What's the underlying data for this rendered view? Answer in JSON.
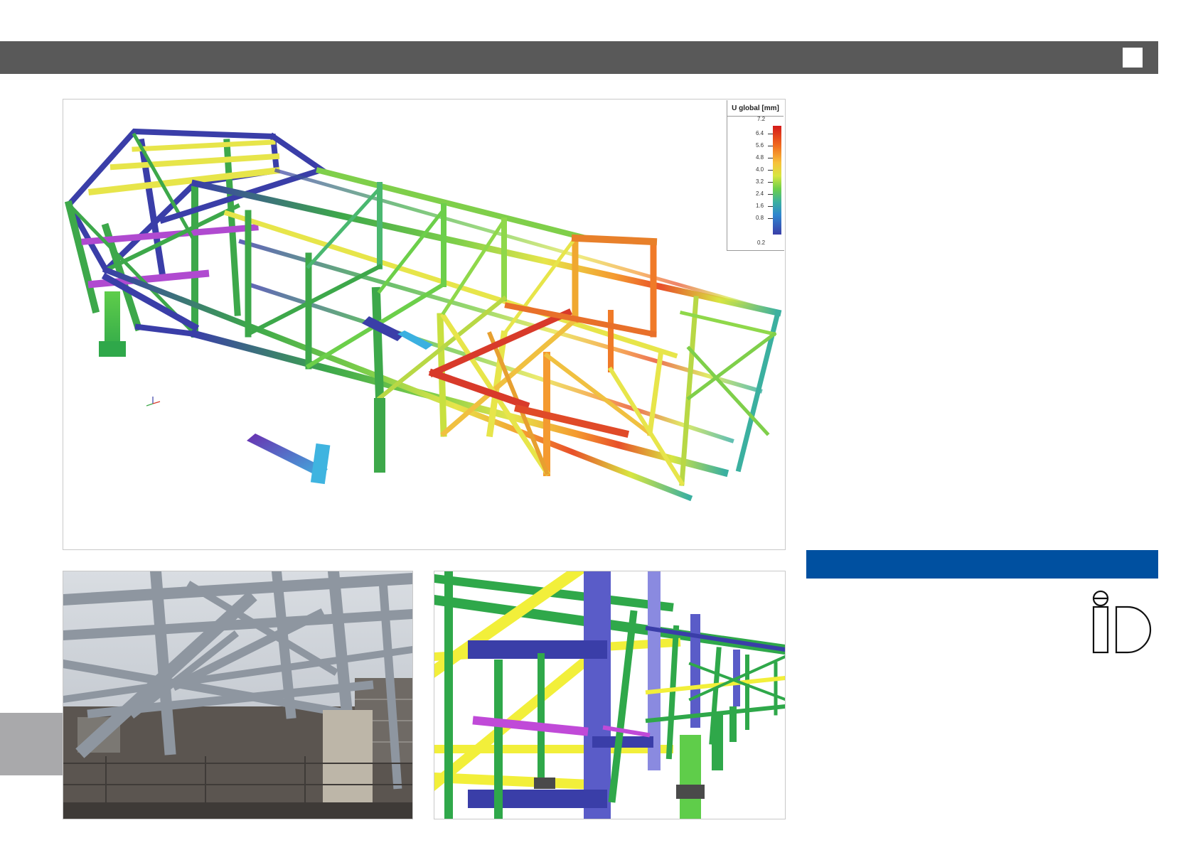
{
  "legend": {
    "title": "U global [mm]",
    "max_label": "7.2",
    "min_label": "0.2",
    "ticks": [
      "6.4",
      "5.6",
      "4.8",
      "4.0",
      "3.2",
      "2.4",
      "1.6",
      "0.8"
    ]
  },
  "colors": {
    "top_bar": "#595959",
    "accent_blue": "#0050a0",
    "grey_tab": "#a9a9ab",
    "panel_border": "#c9c9c9"
  },
  "logo": {
    "text": "iD"
  }
}
